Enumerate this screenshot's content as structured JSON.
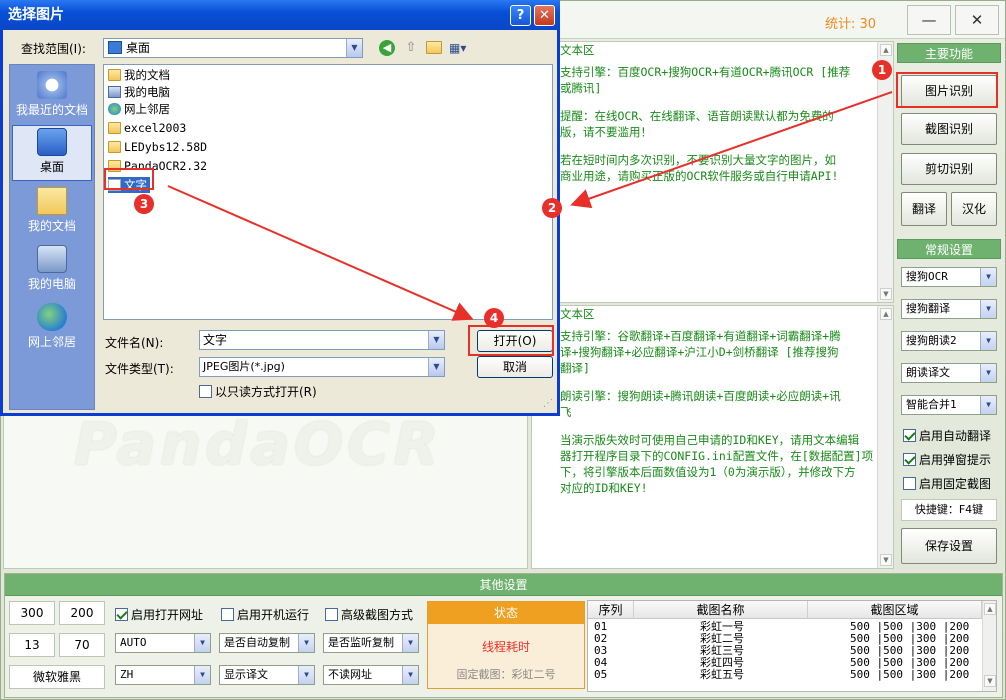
{
  "header": {
    "count_label": "统计:",
    "count_value": "30",
    "minimize": "—",
    "close": "✕"
  },
  "text_panel1": {
    "title": "文本区",
    "lines": [
      "支持引擎：百度OCR+搜狗OCR+有道OCR+腾讯OCR [推荐",
      "或腾讯]",
      "",
      "提醒：在线OCR、在线翻译、语音朗读默认都为免费的",
      "版，请不要滥用！",
      "",
      "若在短时间内多次识别，不要识别大量文字的图片，如",
      "商业用途，请购买正版的OCR软件服务或自行申请API!"
    ]
  },
  "text_panel2": {
    "title": "文本区",
    "lines": [
      "支持引擎：谷歌翻译+百度翻译+有道翻译+词霸翻译+腾",
      "译+搜狗翻译+必应翻译+沪江小D+剑桥翻译 [推荐搜狗",
      "翻译]",
      "",
      "朗读引擎：搜狗朗读+腾讯朗读+百度朗读+必应朗读+讯",
      "飞",
      "",
      "当演示版失效时可使用自己申请的ID和KEY，请用文本编辑",
      "器打开程序目录下的CONFIG.ini配置文件，在[数据配置]项",
      "下，将引擎版本后面数值设为1（0为演示版），并修改下方",
      "对应的ID和KEY!"
    ]
  },
  "watermark": "PandaOCR",
  "side": {
    "main_title": "主要功能",
    "btn_image": "图片识别",
    "btn_screenshot": "截图识别",
    "btn_clipboard": "剪切识别",
    "btn_translate": "翻译",
    "btn_chinese": "汉化",
    "settings_title": "常规设置",
    "ocr_engine": "搜狗OCR",
    "translate_engine": "搜狗翻译",
    "read_engine": "搜狗朗读2",
    "read_mode": "朗读译文",
    "merge_mode": "智能合并1",
    "chk_auto_translate": "启用自动翻译",
    "chk_popup": "启用弹窗提示",
    "chk_fixed": "启用固定截图",
    "hotkey": "快捷键：F4键",
    "save": "保存设置"
  },
  "bottom": {
    "title": "其他设置",
    "n1": "300",
    "n2": "200",
    "n3": "13",
    "n4": "70",
    "font": "微软雅黑",
    "chk_open_url": "启用打开网址",
    "chk_startup": "启用开机运行",
    "chk_advanced": "高级截图方式",
    "sel_auto": "AUTO",
    "sel_autocopy": "是否自动复制",
    "sel_listen": "是否监听复制",
    "sel_zh": "ZH",
    "sel_show": "显示译文",
    "sel_url": "不读网址",
    "status_title": "状态",
    "status_thread": "线程耗时",
    "status_fixed": "固定截图：彩虹二号",
    "table_headers": [
      "序列",
      "截图名称",
      "截图区域"
    ],
    "table_rows": [
      [
        "01",
        "彩虹一号",
        "500 |500 |300 |200"
      ],
      [
        "02",
        "彩虹二号",
        "500 |500 |300 |200"
      ],
      [
        "03",
        "彩虹三号",
        "500 |500 |300 |200"
      ],
      [
        "04",
        "彩虹四号",
        "500 |500 |300 |200"
      ],
      [
        "05",
        "彩虹五号",
        "500 |500 |300 |200"
      ]
    ]
  },
  "dialog": {
    "title": "选择图片",
    "help": "?",
    "close": "✕",
    "lookin_label": "查找范围(I):",
    "lookin_value": "桌面",
    "places": [
      "我最近的文档",
      "桌面",
      "我的文档",
      "我的电脑",
      "网上邻居"
    ],
    "files": [
      "我的文档",
      "我的电脑",
      "网上邻居",
      "excel2003",
      "LEDybs12.58D",
      "PandaOCR2.32",
      "文字"
    ],
    "filename_label": "文件名(N):",
    "filename_value": "文字",
    "filetype_label": "文件类型(T):",
    "filetype_value": "JPEG图片(*.jpg)",
    "readonly_label": "以只读方式打开(R)",
    "open": "打开(O)",
    "cancel": "取消"
  },
  "annotations": {
    "b1": "1",
    "b2": "2",
    "b3": "3",
    "b4": "4"
  },
  "colors": {
    "accent_green": "#6fb26f",
    "annotation_red": "#e8302a",
    "dialog_blue": "#0a46c8",
    "status_orange": "#f0a020",
    "text_green": "#1a8a1a"
  }
}
